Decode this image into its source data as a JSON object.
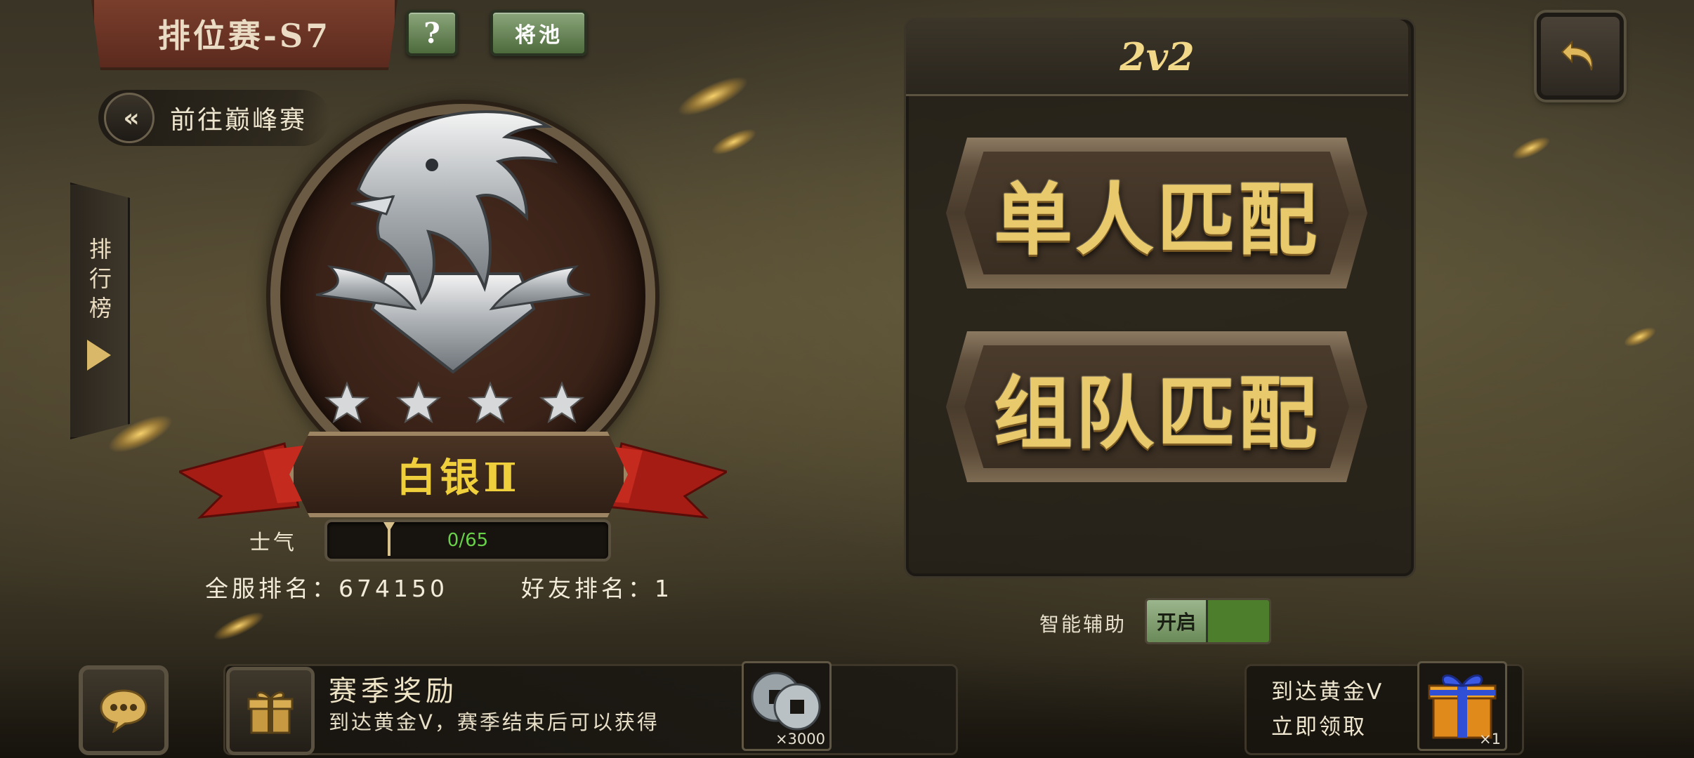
{
  "header": {
    "season_title": "排位赛-S7",
    "help_label": "?",
    "pool_label": "将池"
  },
  "left": {
    "goto_peak_label": "前往巅峰赛",
    "goto_peak_chevron": "«",
    "leaderboard_label": "排行榜",
    "rank_name": "白银Ⅱ",
    "stars_count": 4,
    "morale_label": "士气",
    "morale_text": "0/65",
    "morale_value": 0,
    "morale_max": 65,
    "server_rank_label": "全服排名：",
    "server_rank_value": "674150",
    "friend_rank_label": "好友排名：",
    "friend_rank_value": "1"
  },
  "match": {
    "mode": "2v2",
    "solo_label": "单人匹配",
    "team_label": "组队匹配"
  },
  "assist": {
    "label": "智能辅助",
    "toggle_label": "开启",
    "toggle_color": "#4d7e2c"
  },
  "bottom": {
    "reward_title": "赛季奖励",
    "reward_desc": "到达黄金Ⅴ，赛季结束后可以获得",
    "coin_qty": "×3000",
    "gold_line1": "到达黄金Ⅴ",
    "gold_line2": "立即领取",
    "gift_qty": "×1"
  },
  "icons": {
    "back": "back-arrow-icon",
    "chat": "chat-bubble-icon",
    "gift": "gift-icon",
    "coin": "copper-coin-icon",
    "giftbox": "gift-box-icon",
    "emblem": "silver-eagle-emblem"
  }
}
